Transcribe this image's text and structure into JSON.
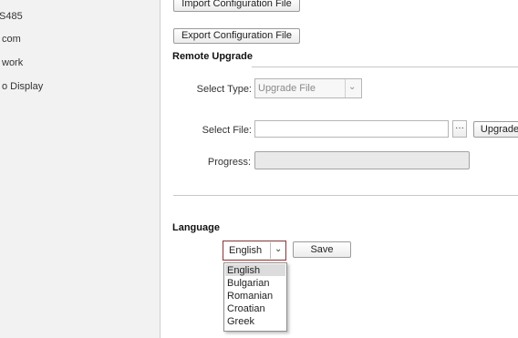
{
  "sidebar": {
    "items": [
      {
        "label": "S485"
      },
      {
        "label": "com"
      },
      {
        "label": "work"
      },
      {
        "label": "o Display"
      }
    ]
  },
  "config": {
    "import_label": "Import Configuration File",
    "export_label": "Export Configuration File"
  },
  "remote_upgrade": {
    "title": "Remote Upgrade",
    "select_type_label": "Select Type:",
    "select_type_value": "Upgrade File",
    "select_file_label": "Select File:",
    "select_file_value": "",
    "browse_label": "···",
    "upgrade_label": "Upgrade",
    "progress_label": "Progress:",
    "progress_fraction": 0
  },
  "language": {
    "title": "Language",
    "selected": "English",
    "save_label": "Save",
    "options": [
      "English",
      "Bulgarian",
      "Romanian",
      "Croatian",
      "Greek"
    ],
    "highlight_color": "#dcdcdc",
    "accent_color": "#d32020"
  }
}
